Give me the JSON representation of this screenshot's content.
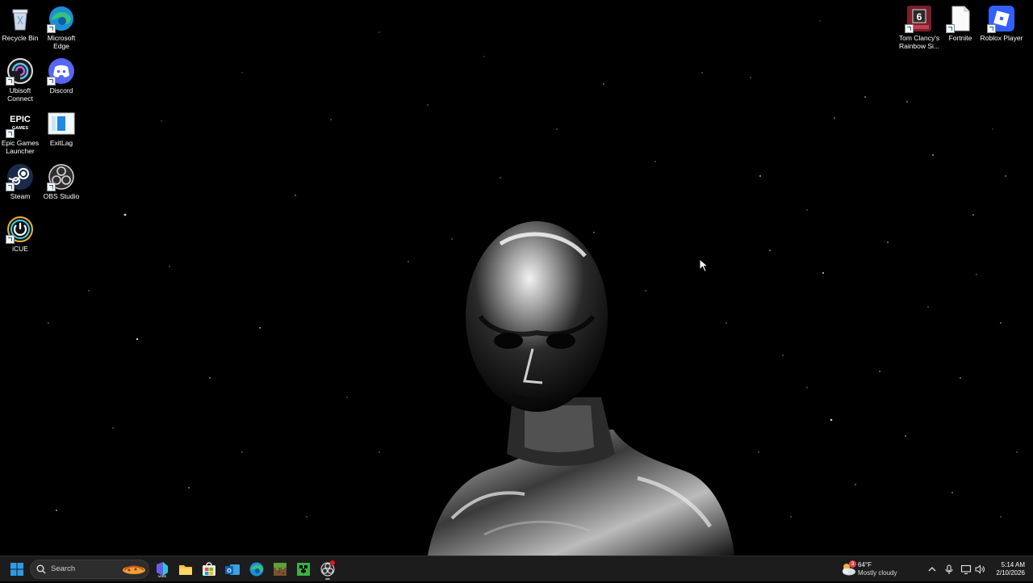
{
  "desktop_icons_left": [
    {
      "name": "recycle-bin",
      "label": "Recycle Bin",
      "icon": "recycle-bin-icon"
    },
    {
      "name": "microsoft-edge",
      "label": "Microsoft\nEdge",
      "icon": "edge-icon"
    },
    {
      "name": "ubisoft-connect",
      "label": "Ubisoft\nConnect",
      "icon": "ubisoft-icon"
    },
    {
      "name": "discord",
      "label": "Discord",
      "icon": "discord-icon"
    },
    {
      "name": "epic-games-launcher",
      "label": "Epic Games\nLauncher",
      "icon": "epic-games-icon"
    },
    {
      "name": "exitlag",
      "label": "ExitLag",
      "icon": "exitlag-icon"
    },
    {
      "name": "steam",
      "label": "Steam",
      "icon": "steam-icon"
    },
    {
      "name": "obs-studio",
      "label": "OBS Studio",
      "icon": "obs-icon"
    },
    {
      "name": "icue",
      "label": "iCUE",
      "icon": "icue-icon"
    }
  ],
  "desktop_icons_right": [
    {
      "name": "rainbow-six",
      "label": "Tom Clancy's\nRainbow Si...",
      "icon": "rainbow-six-icon"
    },
    {
      "name": "fortnite",
      "label": "Fortnite",
      "icon": "file-icon"
    },
    {
      "name": "roblox-player",
      "label": "Roblox Player",
      "icon": "roblox-icon"
    }
  ],
  "taskbar": {
    "search_label": "Search",
    "weather": {
      "temp": "64°F",
      "condition": "Mostly cloudy",
      "badge": "3"
    },
    "clock": {
      "time": "5:14 AM",
      "date": "2/10/2026"
    }
  },
  "colors": {
    "taskbar_bg": "#1c1c1c",
    "windows_blue": "#2f9be8",
    "desktop_bg": "#000000"
  }
}
